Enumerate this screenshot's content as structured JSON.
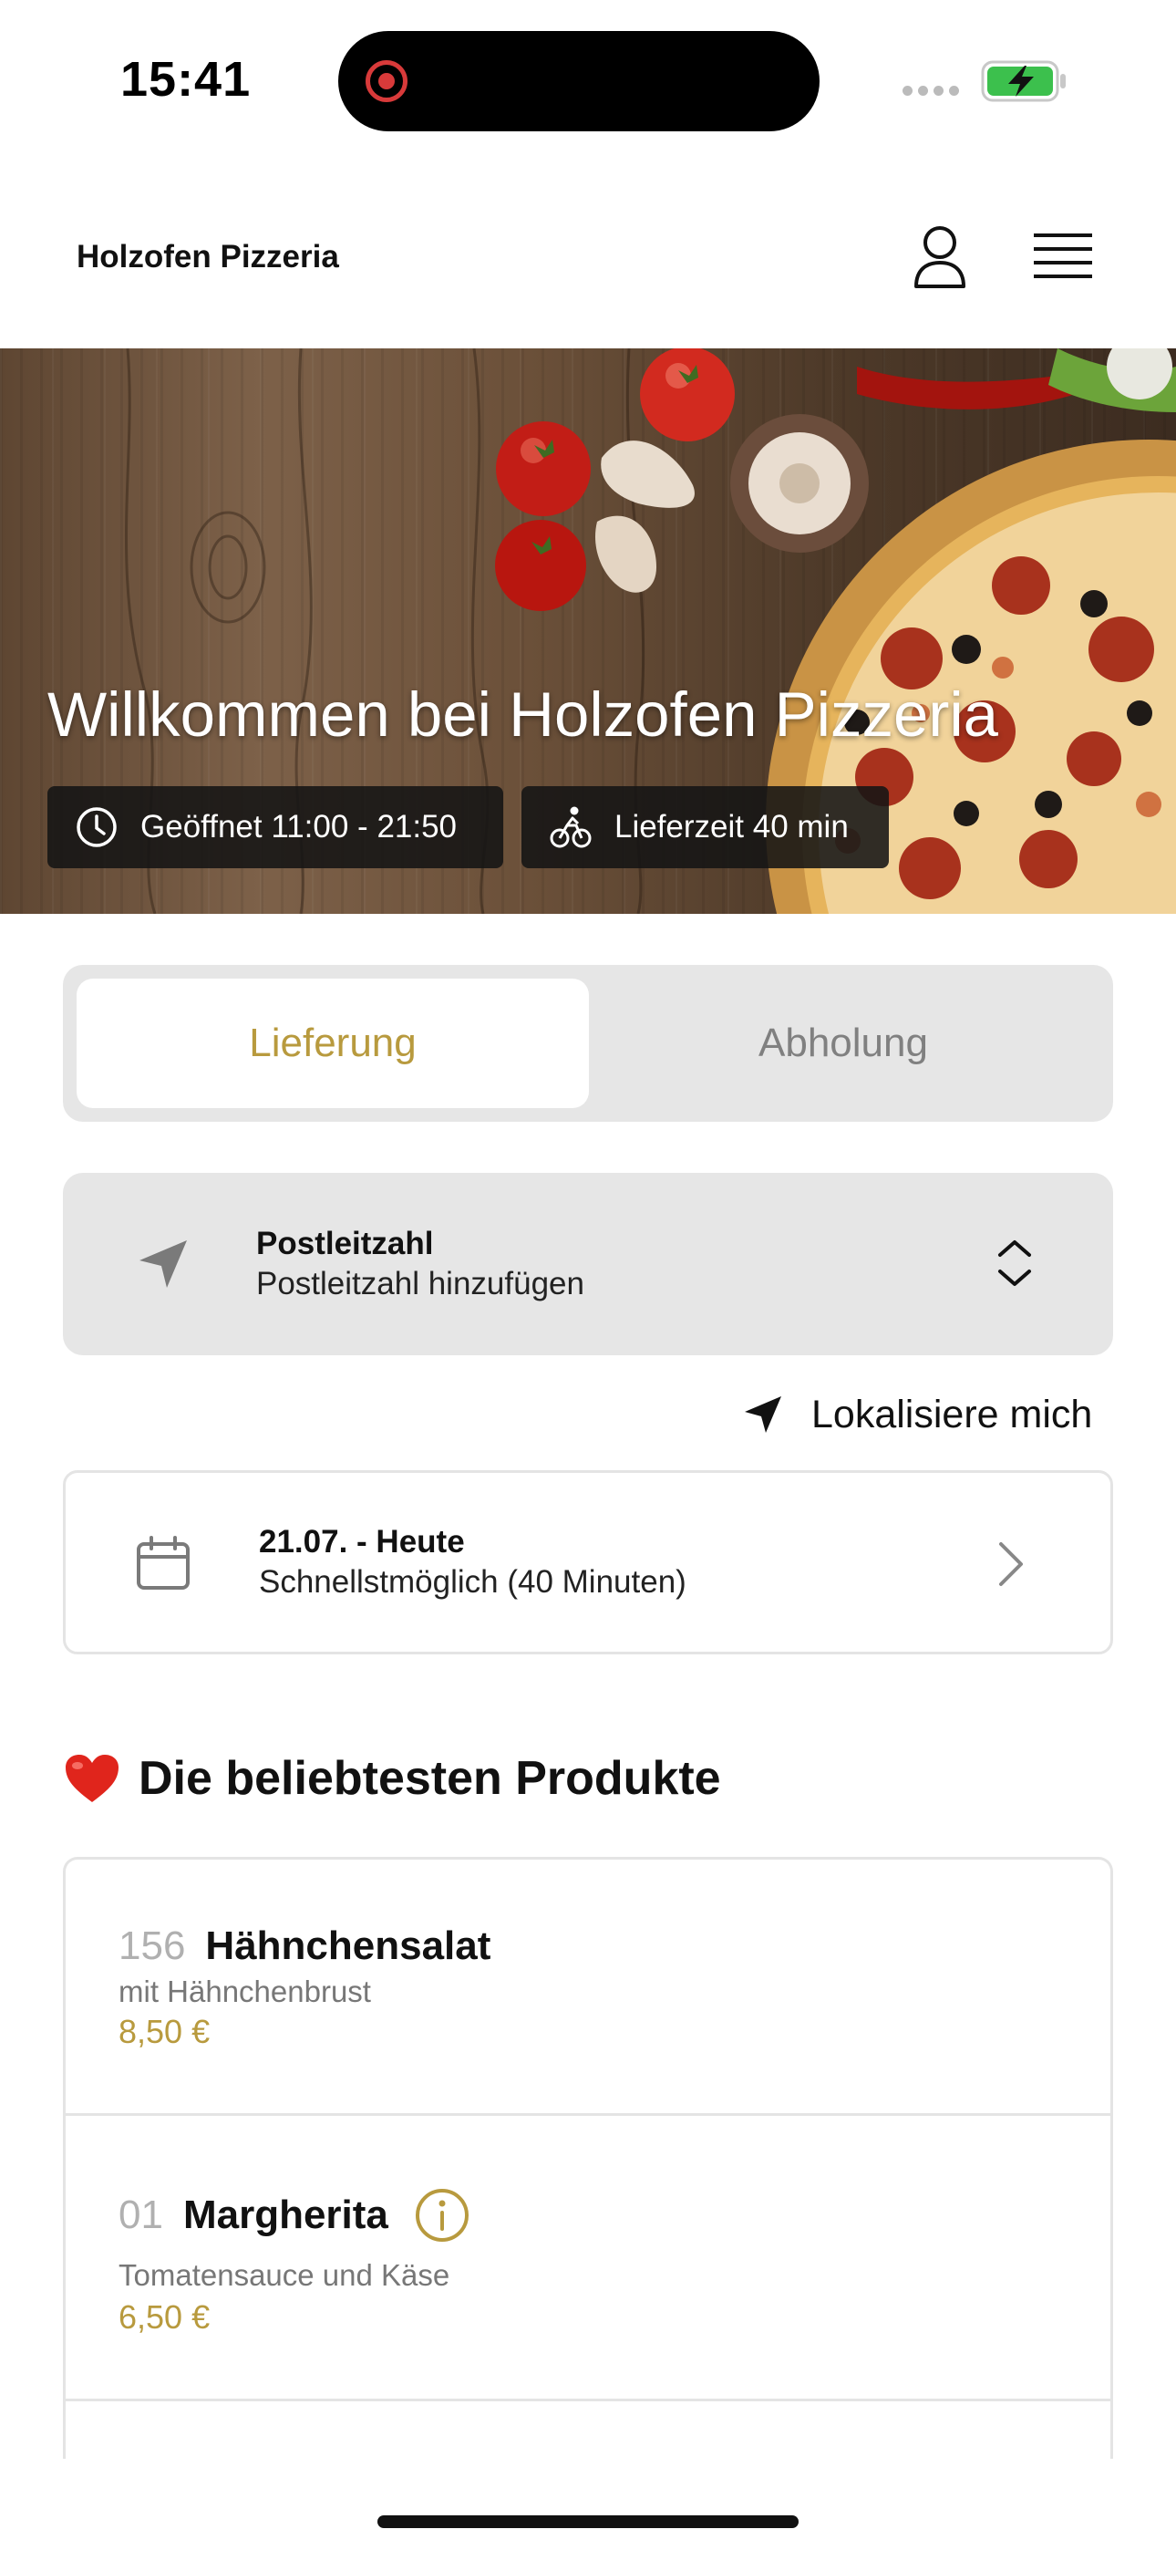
{
  "status_bar": {
    "time": "15:41"
  },
  "header": {
    "brand": "Holzofen Pizzeria"
  },
  "hero": {
    "title": "Willkommen bei Holzofen Pizzeria",
    "open_hours": "Geöffnet 11:00 - 21:50",
    "delivery_time": "Lieferzeit 40 min"
  },
  "mode": {
    "delivery": "Lieferung",
    "pickup": "Abholung",
    "selected": "Lieferung"
  },
  "zip": {
    "title": "Postleitzahl",
    "placeholder": "Postleitzahl hinzufügen"
  },
  "locate": {
    "label": "Lokalisiere mich"
  },
  "date": {
    "title": "21.07. - Heute",
    "subtitle": "Schnellstmöglich (40 Minuten)"
  },
  "popular": {
    "heading": "Die beliebtesten Produkte",
    "products": [
      {
        "number": "156",
        "name": "Hähnchensalat",
        "description": "mit Hähnchenbrust",
        "price": "8,50 €"
      },
      {
        "number": "01",
        "name": "Margherita",
        "description": "Tomatensauce und Käse",
        "price": "6,50 €"
      }
    ]
  },
  "colors": {
    "accent": "#b89a3e",
    "panel": "#e6e6e6",
    "chip": "#141414"
  },
  "icons": [
    "user-icon",
    "menu-icon",
    "clock-icon",
    "bike-icon",
    "navigation-arrow-icon",
    "chevron-up-down-icon",
    "calendar-icon",
    "chevron-right-icon",
    "heart-icon",
    "info-icon"
  ]
}
